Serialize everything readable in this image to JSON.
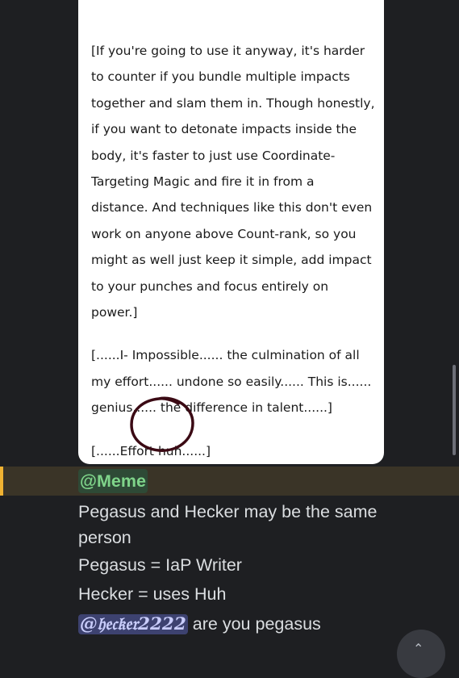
{
  "document": {
    "paragraphs": [
      "[If you're going to use it anyway, it's harder to counter if you bundle multiple impacts together and slam them in. Though honestly, if you want to detonate impacts inside the body, it's faster to just use Coordinate-Targeting Magic and fire it in from a distance. And techniques like this don't even work on anyone above Count-rank, so you might as well just keep it simple, add impact to your punches and focus entirely on power.]",
      "[......I- Impossible...... the culmination of all my effort...... undone so easily...... This is...... genius...... the difference in talent......]",
      "[......Effort huh......]"
    ]
  },
  "chat": {
    "role_mention": "@Meme",
    "lines": [
      "Pegasus and Hecker may be the same person",
      "Pegasus = IaP Writer",
      "Hecker = uses Huh"
    ],
    "user_mention": "@𝔥𝔢𝔠𝔨𝔢𝔯2222",
    "last_line_text": " are you pegasus"
  },
  "colors": {
    "highlight_bar": "#f0b232",
    "role_mention_bg": "#2e4a36",
    "user_mention_bg": "#3d4270",
    "annotation_circle": "#3b0a14"
  },
  "icons": {
    "fab": "chevron-icon",
    "annotation": "hand-drawn-circle"
  }
}
